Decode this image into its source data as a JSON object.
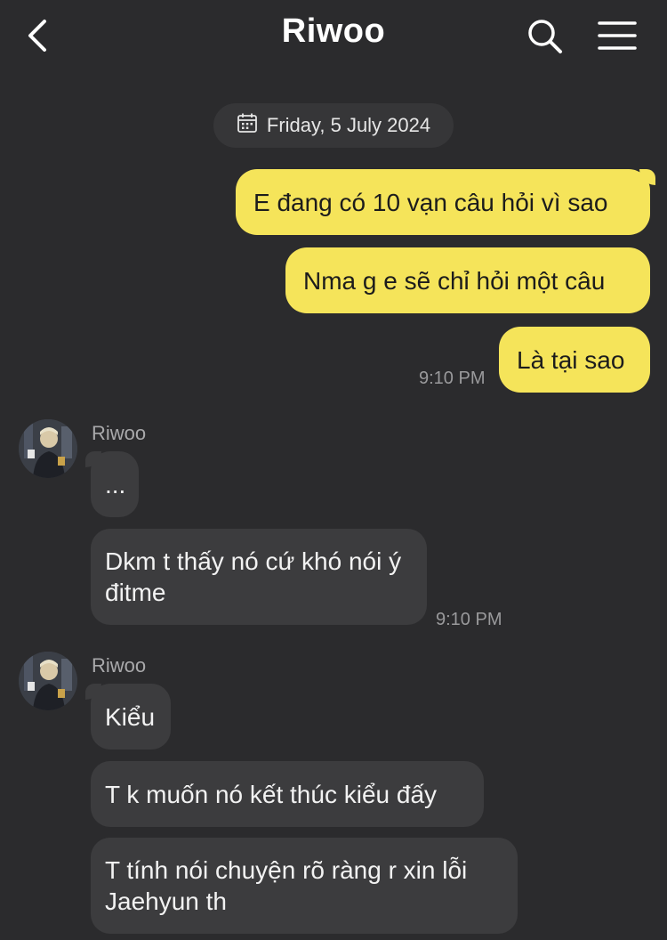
{
  "header": {
    "title": "Riwoo",
    "back_icon": "chevron-left-icon",
    "search_icon": "search-icon",
    "menu_icon": "hamburger-menu-icon"
  },
  "date_divider": {
    "icon": "calendar-icon",
    "text": "Friday, 5 July 2024"
  },
  "outgoing": {
    "messages": [
      "E đang có 10 vạn câu hỏi vì sao",
      "Nma g e sẽ chỉ hỏi một câu",
      "Là tại sao"
    ],
    "time": "9:10 PM"
  },
  "incoming_group_1": {
    "sender": "Riwoo",
    "messages": [
      "...",
      "Dkm t thấy nó cứ khó nói ý đitme"
    ],
    "time": "9:10 PM"
  },
  "incoming_group_2": {
    "sender": "Riwoo",
    "messages": [
      "Kiểu",
      "T k muốn nó kết thúc kiểu đấy",
      "T tính nói chuyện rõ ràng r xin lỗi Jaehyun th"
    ]
  },
  "colors": {
    "background": "#2b2b2d",
    "outgoing_bubble": "#f5e45a",
    "incoming_bubble": "#3c3c3e"
  }
}
